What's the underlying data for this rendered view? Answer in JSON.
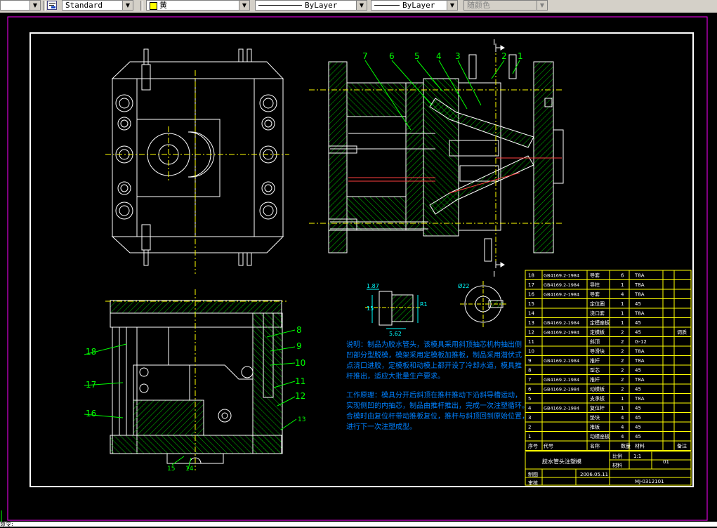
{
  "toolbar": {
    "text_style": "Standard",
    "color_name": "黄",
    "linetype": "ByLayer",
    "lineweight": "ByLayer",
    "plot_style": "随颜色"
  },
  "drawing": {
    "part_labels": [
      "1",
      "2",
      "3",
      "4",
      "5",
      "6",
      "7",
      "8",
      "9",
      "10",
      "11",
      "12",
      "13",
      "14",
      "15",
      "16",
      "17",
      "18"
    ],
    "section_mark": "I",
    "dims": {
      "d1": "1.87",
      "d2": "15",
      "d3": "5.62",
      "d4": "R1",
      "d5": "Ø22"
    },
    "notes": [
      "说明：制品为胶水管头，该模具采用斜顶抽芯机构抽出侧",
      "凹部分型脱模，模架采用定模板加推板，制品采用潜伏式",
      "点浇口进胶，定模板和动模上都开设了冷却水道，模具推",
      "杆推出，适应大批量生产要求。",
      "工作原理：模具分开后斜顶在推杆推动下沿斜导槽运动，",
      "实现侧凹的内抽芯，制品由推杆推出，完成一次注塑循环。",
      "合模时由复位杆带动推板复位，推杆与斜顶回到原始位置，",
      "进行下一次注塑成型。"
    ],
    "bom_rows": [
      {
        "no": "18",
        "code": "GB4169.2-1984",
        "name": "导套",
        "qty": "6",
        "mat": "T8A",
        "note": ""
      },
      {
        "no": "17",
        "code": "GB4169.2-1984",
        "name": "导柱",
        "qty": "1",
        "mat": "T8A",
        "note": ""
      },
      {
        "no": "16",
        "code": "GB4169.2-1984",
        "name": "导套",
        "qty": "4",
        "mat": "T8A",
        "note": ""
      },
      {
        "no": "15",
        "code": "",
        "name": "定位圈",
        "qty": "1",
        "mat": "45",
        "note": ""
      },
      {
        "no": "14",
        "code": "",
        "name": "浇口套",
        "qty": "1",
        "mat": "T8A",
        "note": ""
      },
      {
        "no": "13",
        "code": "GB4169.2-1984",
        "name": "定模座板",
        "qty": "1",
        "mat": "45",
        "note": ""
      },
      {
        "no": "12",
        "code": "GB4169.2-1984",
        "name": "定模板",
        "qty": "2",
        "mat": "45",
        "note": "调质"
      },
      {
        "no": "11",
        "code": "",
        "name": "斜顶",
        "qty": "2",
        "mat": "G-12",
        "note": ""
      },
      {
        "no": "10",
        "code": "",
        "name": "导滑块",
        "qty": "2",
        "mat": "T8A",
        "note": ""
      },
      {
        "no": "9",
        "code": "GB4169.2-1984",
        "name": "推杆",
        "qty": "2",
        "mat": "T8A",
        "note": ""
      },
      {
        "no": "8",
        "code": "",
        "name": "型芯",
        "qty": "2",
        "mat": "45",
        "note": ""
      },
      {
        "no": "7",
        "code": "GB4169.2-1984",
        "name": "推杆",
        "qty": "2",
        "mat": "T8A",
        "note": ""
      },
      {
        "no": "6",
        "code": "GB4169.2-1984",
        "name": "动模板",
        "qty": "2",
        "mat": "45",
        "note": ""
      },
      {
        "no": "5",
        "code": "",
        "name": "支承板",
        "qty": "1",
        "mat": "T8A",
        "note": ""
      },
      {
        "no": "4",
        "code": "GB4169.2-1984",
        "name": "复位杆",
        "qty": "1",
        "mat": "45",
        "note": ""
      },
      {
        "no": "3",
        "code": "",
        "name": "垫块",
        "qty": "4",
        "mat": "45",
        "note": ""
      },
      {
        "no": "2",
        "code": "",
        "name": "推板",
        "qty": "4",
        "mat": "45",
        "note": ""
      },
      {
        "no": "1",
        "code": "",
        "name": "动模座板",
        "qty": "4",
        "mat": "45",
        "note": ""
      }
    ],
    "bom_header": {
      "no": "序号",
      "code": "代号",
      "name": "名称",
      "qty": "数量",
      "mat": "材料",
      "note": "备注"
    },
    "title_block": {
      "title": "胶水管头注塑模",
      "scale_label": "比例",
      "scale": "1:1",
      "sheet_label": "材料",
      "sheet_no": "01",
      "designer_label": "制图",
      "checker_label": "审核",
      "date": "2006.05.11",
      "drawing_no": "MJ-0312101"
    }
  },
  "cmdline": {
    "text": "命令:"
  }
}
